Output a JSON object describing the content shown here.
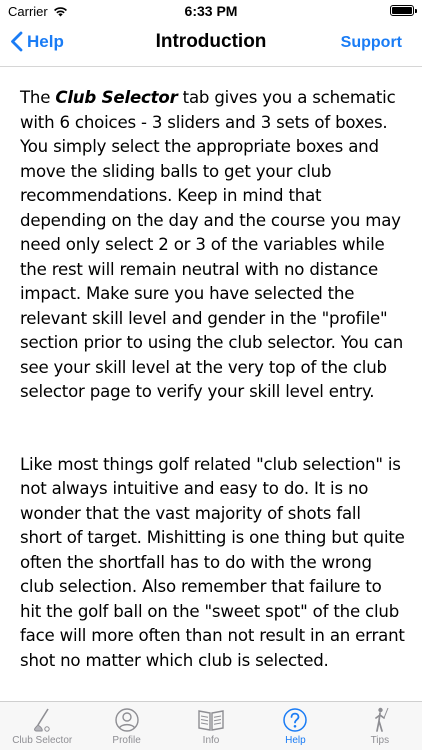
{
  "status": {
    "carrier": "Carrier",
    "time": "6:33 PM"
  },
  "nav": {
    "back_label": "Help",
    "title": "Introduction",
    "support_label": "Support"
  },
  "content": {
    "p1_lead": "The ",
    "p1_emph": "Club Selector",
    "p1_rest": " tab gives you a schematic with 6 choices - 3 sliders and 3 sets of boxes. You simply select the appropriate boxes and move the sliding balls to get your club recommendations. Keep in mind that depending on the day and the course you may need only select 2 or 3 of the variables while the rest will remain neutral with no distance impact. Make sure you have selected the relevant skill level and gender in the \"profile\" section prior to using the club selector. You can see your skill level at the very top of the club selector page to verify your skill level entry.",
    "p2": "Like most things golf related \"club selection\" is not always intuitive and easy to do. It is no wonder that the vast majority of shots fall short of target. Mishitting is one thing but quite often the shortfall has to do with the wrong club selection. Also remember that failure to hit the golf ball on the \"sweet spot\" of the club face will more often than not result in an errant shot no matter which club is selected."
  },
  "tabs": [
    {
      "label": "Club Selector",
      "icon": "golf-club-icon",
      "active": false
    },
    {
      "label": "Profile",
      "icon": "person-icon",
      "active": false
    },
    {
      "label": "Info",
      "icon": "book-icon",
      "active": false
    },
    {
      "label": "Help",
      "icon": "question-icon",
      "active": true
    },
    {
      "label": "Tips",
      "icon": "golfer-icon",
      "active": false
    }
  ],
  "colors": {
    "accent": "#1a7cf5",
    "inactive": "#8e8e93"
  }
}
